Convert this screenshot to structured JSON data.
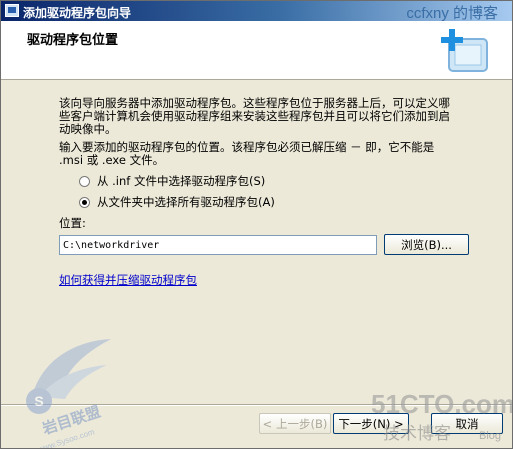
{
  "window": {
    "title": "添加驱动程序包向导",
    "watermark": "ccfxny 的博客"
  },
  "header": {
    "title": "驱动程序包位置"
  },
  "content": {
    "description": "该向导向服务器中添加驱动程序包。这些程序包位于服务器上后，可以定义哪些客户端计算机会使用驱动程序组来安装这些程序包并且可以将它们添加到启动映像中。",
    "instruction": "输入要添加的驱动程序包的位置。该程序包必须已解压缩 － 即，它不能是 .msi 或 .exe 文件。",
    "options": [
      {
        "label": "从 .inf 文件中选择驱动程序包(S)",
        "checked": false
      },
      {
        "label": "从文件夹中选择所有驱动程序包(A)",
        "checked": true
      }
    ],
    "location_label": "位置:",
    "location_value": "C:\\networkdriver",
    "browse_label": "浏览(B)...",
    "help_link": "如何获得并压缩驱动程序包"
  },
  "footer": {
    "back_label": "< 上一步(B)",
    "next_label": "下一步(N) >",
    "cancel_label": "取消"
  },
  "watermarks": {
    "left_text": "S",
    "left_caption": "岩目联盟",
    "left_url": "www.Sysoo.com",
    "right_brand": "51CTO.com",
    "right_caption": "技术博客",
    "right_blog": "Blog"
  },
  "icons": {
    "title": "wizard-window-icon",
    "header": "driver-package-plus-icon",
    "radio": "radio-button-icon"
  }
}
